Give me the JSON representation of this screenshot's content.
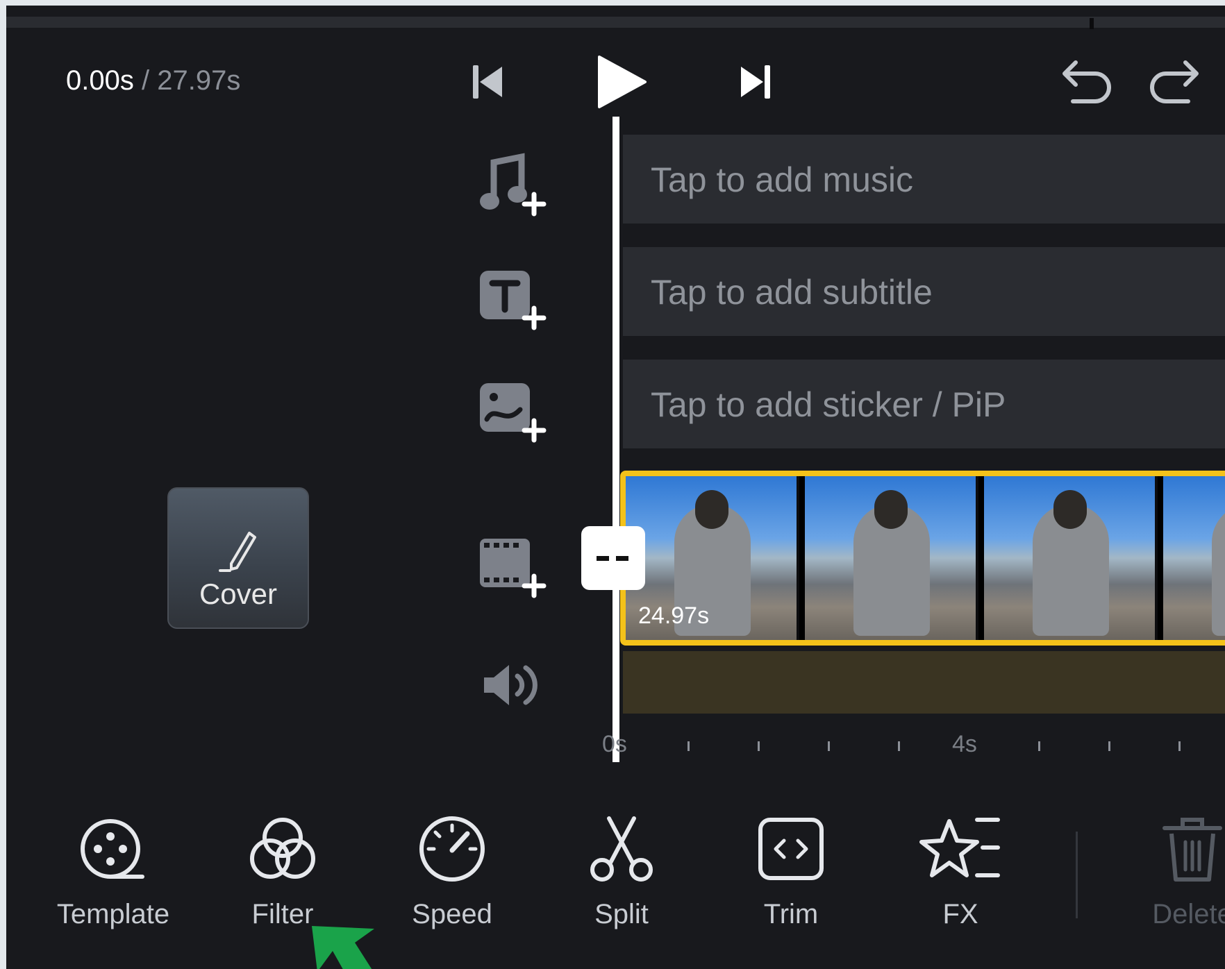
{
  "header": {
    "current_time": "0.00s",
    "separator": "/",
    "total_time": "27.97s",
    "controls": [
      "skip-start-icon",
      "play-icon",
      "skip-end-icon",
      "undo-icon",
      "redo-icon"
    ]
  },
  "tracks": [
    {
      "icon": "music-add-icon",
      "label": "Tap to add music"
    },
    {
      "icon": "text-add-icon",
      "label": "Tap to add subtitle"
    },
    {
      "icon": "sticker-add-icon",
      "label": "Tap to add sticker / PiP"
    }
  ],
  "cover": {
    "label": "Cover"
  },
  "clip": {
    "duration": "24.97s",
    "border_color": "#f4c21a"
  },
  "ruler": {
    "labels": [
      "0s",
      "4s"
    ]
  },
  "toolbar": {
    "tools": [
      {
        "icon": "template-icon",
        "label": "Template"
      },
      {
        "icon": "filter-icon",
        "label": "Filter"
      },
      {
        "icon": "speed-icon",
        "label": "Speed"
      },
      {
        "icon": "split-icon",
        "label": "Split"
      },
      {
        "icon": "trim-icon",
        "label": "Trim"
      },
      {
        "icon": "fx-icon",
        "label": "FX"
      },
      {
        "icon": "delete-icon",
        "label": "Delete"
      }
    ]
  },
  "colors": {
    "background": "#18191d",
    "track": "#2a2c31",
    "clip_highlight": "#f4c21a",
    "annotation_arrow": "#1aa34a"
  }
}
